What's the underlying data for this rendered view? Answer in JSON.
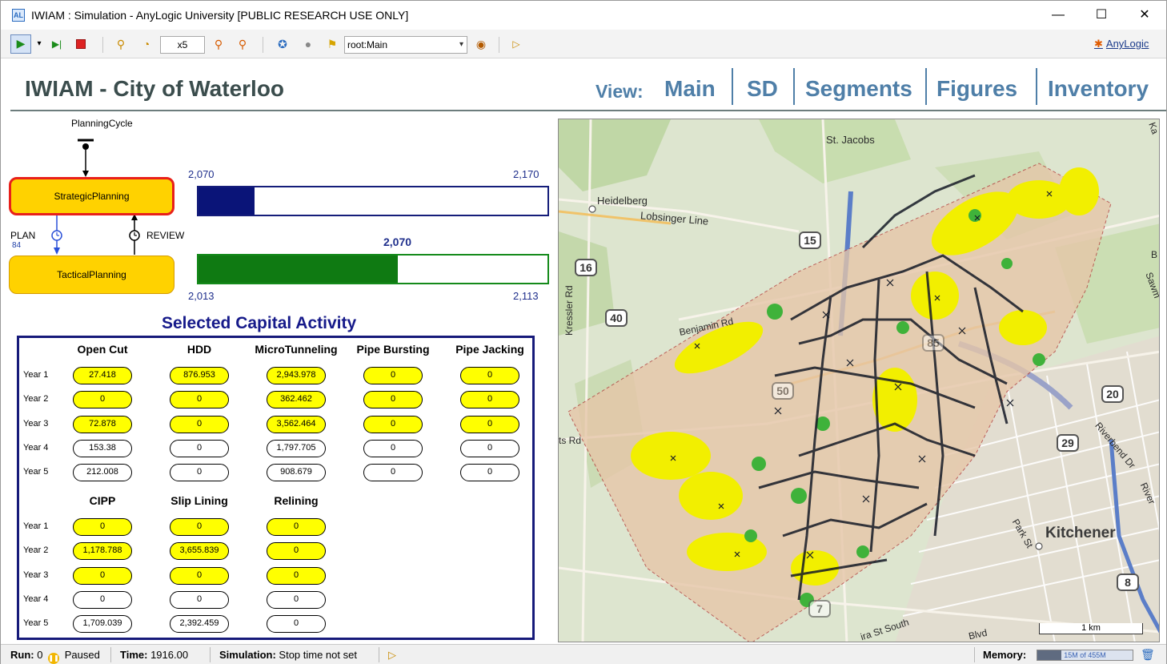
{
  "window": {
    "title": "IWIAM : Simulation - AnyLogic University  [PUBLIC RESEARCH USE ONLY]",
    "app_icon": "AL",
    "minimize": "—",
    "maximize": "☐",
    "close": "✕"
  },
  "toolbar": {
    "run": "▶",
    "run_dropdown": "▾",
    "step": "▶|",
    "slower": "⚲",
    "realtime": "◔",
    "speed": "x5",
    "faster": "⚲",
    "virtual_time": "⚲",
    "navigate": "✪",
    "camera": "●",
    "folder": "⚑",
    "agent": "root:Main",
    "agent_caret": "▾",
    "agent_btn": "◉",
    "log": "▷",
    "brand": "AnyLogic",
    "brand_mark": "✱"
  },
  "header": {
    "title": "IWIAM - City of Waterloo",
    "view_label": "View:",
    "nav": [
      "Main",
      "SD",
      "Segments",
      "Figures",
      "Inventory"
    ]
  },
  "statechart": {
    "label": "PlanningCycle",
    "strategic": "StrategicPlanning",
    "tactical": "TacticalPlanning",
    "plan": "PLAN",
    "plan_count": "84",
    "review": "REVIEW"
  },
  "bars": {
    "blue": {
      "min": "2,070",
      "max": "2,170",
      "fill_fraction": 0.16
    },
    "green": {
      "min": "2,013",
      "max": "2,113",
      "value": "2,070",
      "fill_fraction": 0.57
    }
  },
  "capital": {
    "title": "Selected Capital Activity",
    "year_labels": [
      "Year 1",
      "Year 2",
      "Year 3",
      "Year 4",
      "Year 5"
    ],
    "group1": {
      "columns": [
        "Open Cut",
        "HDD",
        "MicroTunneling",
        "Pipe Bursting",
        "Pipe Jacking"
      ],
      "values": [
        [
          "27.418",
          "876.953",
          "2,943.978",
          "0",
          "0"
        ],
        [
          "0",
          "0",
          "362.462",
          "0",
          "0"
        ],
        [
          "72.878",
          "0",
          "3,562.464",
          "0",
          "0"
        ],
        [
          "153.38",
          "0",
          "1,797.705",
          "0",
          "0"
        ],
        [
          "212.008",
          "0",
          "908.679",
          "0",
          "0"
        ]
      ],
      "highlighted": [
        [
          true,
          true,
          true,
          true,
          true
        ],
        [
          true,
          true,
          true,
          true,
          true
        ],
        [
          true,
          true,
          true,
          true,
          true
        ],
        [
          false,
          false,
          false,
          false,
          false
        ],
        [
          false,
          false,
          false,
          false,
          false
        ]
      ]
    },
    "group2": {
      "columns": [
        "CIPP",
        "Slip Lining",
        "Relining"
      ],
      "values": [
        [
          "0",
          "0",
          "0"
        ],
        [
          "1,178.788",
          "3,655.839",
          "0"
        ],
        [
          "0",
          "0",
          "0"
        ],
        [
          "0",
          "0",
          "0"
        ],
        [
          "1,709.039",
          "2,392.459",
          "0"
        ]
      ],
      "highlighted": [
        [
          true,
          true,
          true
        ],
        [
          true,
          true,
          true
        ],
        [
          true,
          true,
          true
        ],
        [
          false,
          false,
          false
        ],
        [
          false,
          false,
          false
        ]
      ]
    },
    "highlight_color": "#ffff00"
  },
  "map": {
    "labels": {
      "st_jacobs": "St. Jacobs",
      "heidelberg": "Heidelberg",
      "lobsinger": "Lobsinger Line",
      "benjamin": "Benjamin Rd",
      "kressler": "Kressler Rd",
      "ts_rd": "ts Rd",
      "park": "Park St",
      "riverbend": "Riverbend Dr",
      "river": "River",
      "sawmill": "Sawm",
      "ka": "Ka",
      "b": "B",
      "ira_south": "ira St South",
      "blvd": "Blvd",
      "kitchener": "Kitchener"
    },
    "highways": [
      "15",
      "16",
      "40",
      "50",
      "20",
      "29",
      "8",
      "85",
      "7"
    ],
    "scale": "1 km"
  },
  "status": {
    "run_label": "Run:",
    "run_value": "0",
    "paused": "Paused",
    "pause_icon": "❚❚",
    "time_label": "Time:",
    "time_value": "1916.00",
    "sim_label": "Simulation:",
    "sim_value": "Stop time not set",
    "log_icon": "▷",
    "memory_label": "Memory:",
    "memory_text": "15M of 455M",
    "memory_fraction": 0.25,
    "gc_icon": "🗑"
  }
}
